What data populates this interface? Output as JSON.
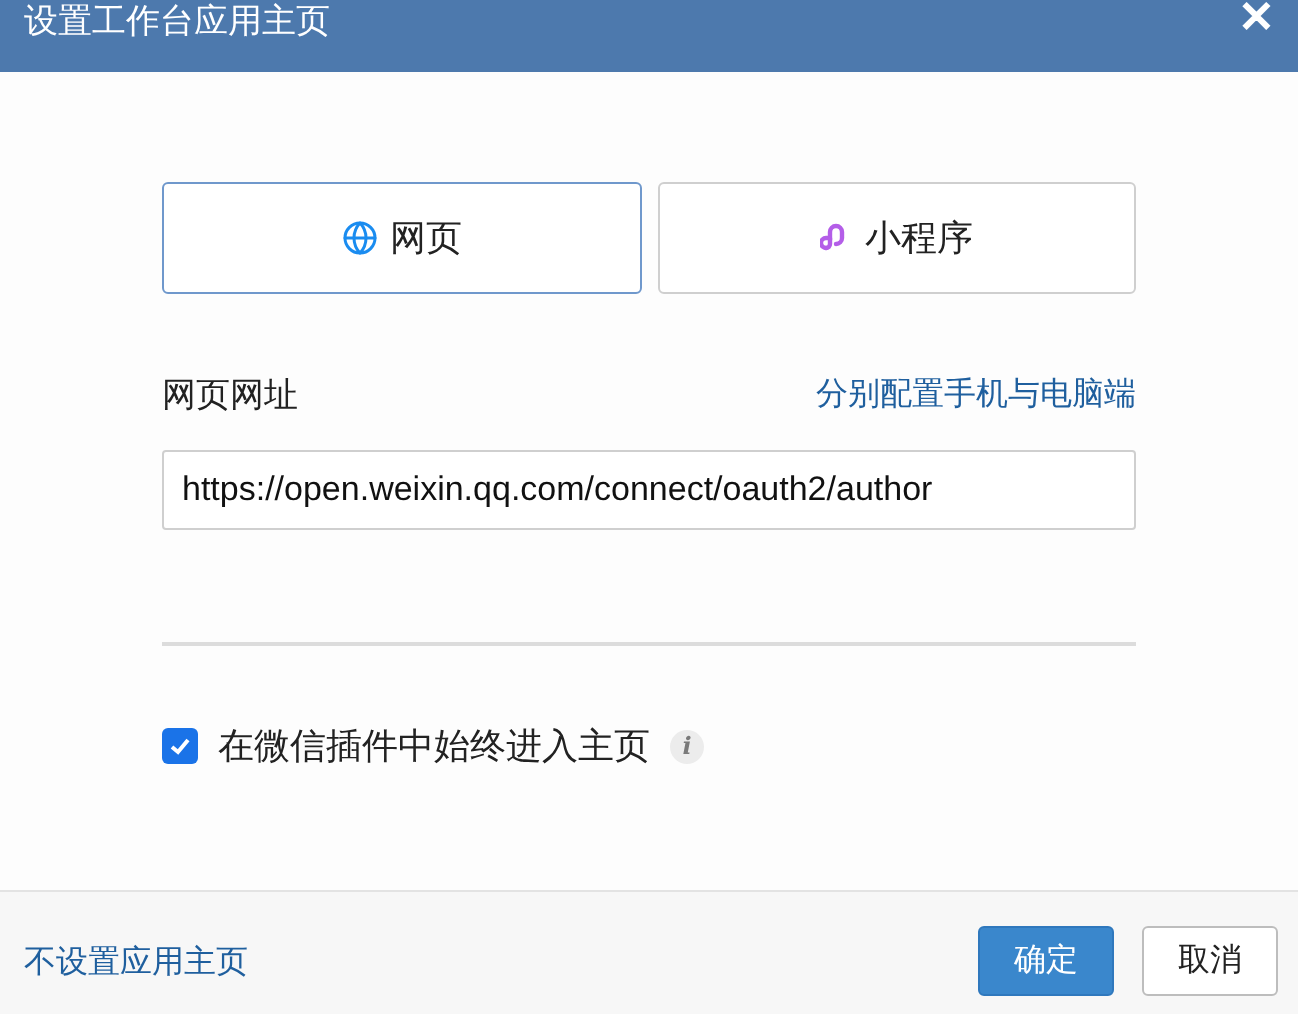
{
  "dialog": {
    "title": "设置工作台应用主页",
    "close": "✕"
  },
  "tabs": [
    {
      "label": "网页",
      "kind": "web",
      "selected": true
    },
    {
      "label": "小程序",
      "kind": "miniprogram",
      "selected": false
    }
  ],
  "url_field": {
    "label": "网页网址",
    "link": "分别配置手机与电脑端",
    "value": "https://open.weixin.qq.com/connect/oauth2/author"
  },
  "option": {
    "label": "在微信插件中始终进入主页",
    "checked": true,
    "info": "i"
  },
  "footer": {
    "link": "不设置应用主页",
    "buttons": [
      {
        "label": "确定",
        "kind": "primary"
      },
      {
        "label": "取消",
        "kind": "default"
      }
    ]
  }
}
